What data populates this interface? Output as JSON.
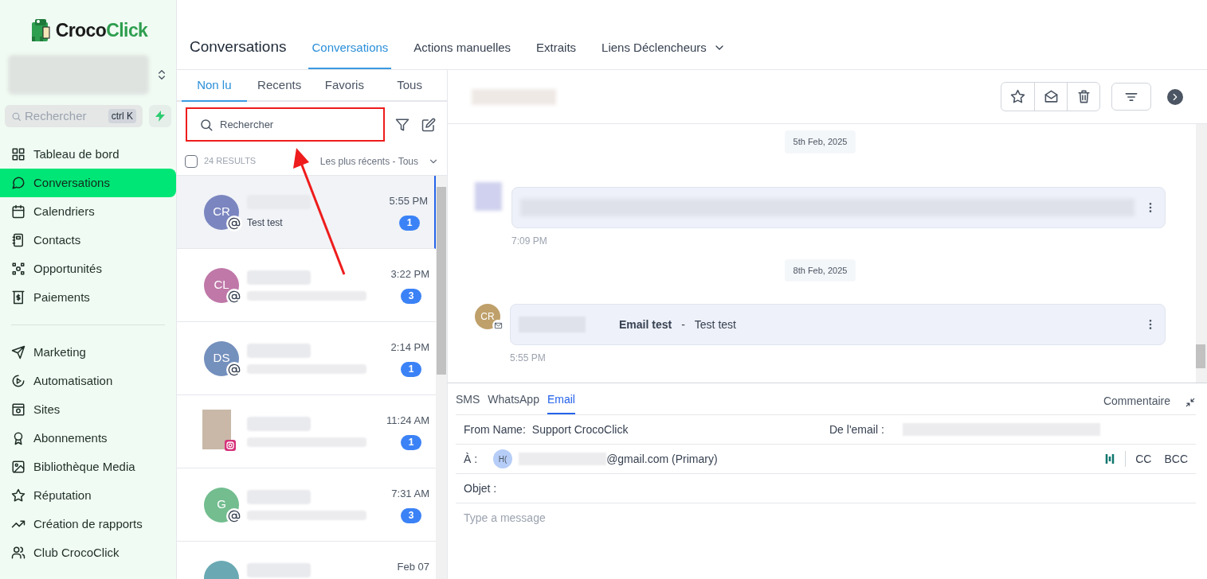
{
  "logo": {
    "text_a": "Croco",
    "text_b": "Click"
  },
  "sidebar": {
    "search": {
      "placeholder": "Rechercher",
      "shortcut": "ctrl K"
    },
    "sections": [
      [
        {
          "label": "Tableau de bord",
          "selected": false
        },
        {
          "label": "Conversations",
          "selected": true
        },
        {
          "label": "Calendriers",
          "selected": false
        },
        {
          "label": "Contacts",
          "selected": false
        },
        {
          "label": "Opportunités",
          "selected": false
        },
        {
          "label": "Paiements",
          "selected": false
        }
      ],
      [
        {
          "label": "Marketing",
          "selected": false
        },
        {
          "label": "Automatisation",
          "selected": false
        },
        {
          "label": "Sites",
          "selected": false
        },
        {
          "label": "Abonnements",
          "selected": false
        },
        {
          "label": "Bibliothèque Media",
          "selected": false
        },
        {
          "label": "Réputation",
          "selected": false
        },
        {
          "label": "Création de rapports",
          "selected": false
        },
        {
          "label": "Club CrocoClick",
          "selected": false
        }
      ]
    ]
  },
  "header": {
    "title": "Conversations",
    "tabs": [
      {
        "label": "Conversations",
        "selected": true,
        "has_menu": false
      },
      {
        "label": "Actions manuelles",
        "selected": false,
        "has_menu": false
      },
      {
        "label": "Extraits",
        "selected": false,
        "has_menu": false
      },
      {
        "label": "Liens Déclencheurs",
        "selected": false,
        "has_menu": true
      }
    ]
  },
  "list": {
    "tabs": [
      {
        "label": "Non lu",
        "selected": true
      },
      {
        "label": "Recents",
        "selected": false
      },
      {
        "label": "Favoris",
        "selected": false
      },
      {
        "label": "Tous",
        "selected": false
      }
    ],
    "search": {
      "placeholder": "Rechercher"
    },
    "select_all": {
      "checked": false
    },
    "results": "24 RESULTS",
    "sort": "Les plus récents - Tous",
    "conversations": [
      {
        "kind": "initials",
        "initials": "CR",
        "color": "#7b86c0",
        "preview": "Test test",
        "time": "5:55 PM",
        "unread": "1",
        "selected": true
      },
      {
        "kind": "initials",
        "initials": "CL",
        "color": "#bf78a8",
        "time": "3:22 PM",
        "unread": "3",
        "selected": false
      },
      {
        "kind": "initials",
        "initials": "DS",
        "color": "#7490bd",
        "time": "2:14 PM",
        "unread": "1",
        "selected": false
      },
      {
        "kind": "photo",
        "time": "11:24 AM",
        "unread": "1",
        "selected": false
      },
      {
        "kind": "initials",
        "initials": "G",
        "color": "#73bd8f",
        "time": "7:31 AM",
        "unread": "3",
        "selected": false
      },
      {
        "kind": "blank",
        "color": "#6aa9b3",
        "time": "Feb 07",
        "selected": false
      }
    ]
  },
  "thread": {
    "items": [
      {
        "kind": "date",
        "text": "5th Feb, 2025"
      },
      {
        "kind": "message",
        "time": "7:09 PM"
      },
      {
        "kind": "date",
        "text": "8th Feb, 2025"
      },
      {
        "kind": "message",
        "initials": "CR",
        "subject": "Email test",
        "separator": "-",
        "body": "Test test",
        "time": "5:55 PM"
      }
    ]
  },
  "composer": {
    "tabs": [
      {
        "label": "SMS",
        "selected": false
      },
      {
        "label": "WhatsApp",
        "selected": false
      },
      {
        "label": "Email",
        "selected": true
      }
    ],
    "comment": "Commentaire",
    "from_label": "From Name:",
    "from_value": "Support CrocoClick",
    "de_label": "De l'email :",
    "to_label": "À :",
    "to_initials": "H(",
    "to_email": "@gmail.com (Primary)",
    "cc": "CC",
    "bcc": "BCC",
    "subject_label": "Objet :",
    "placeholder": "Type a message"
  }
}
